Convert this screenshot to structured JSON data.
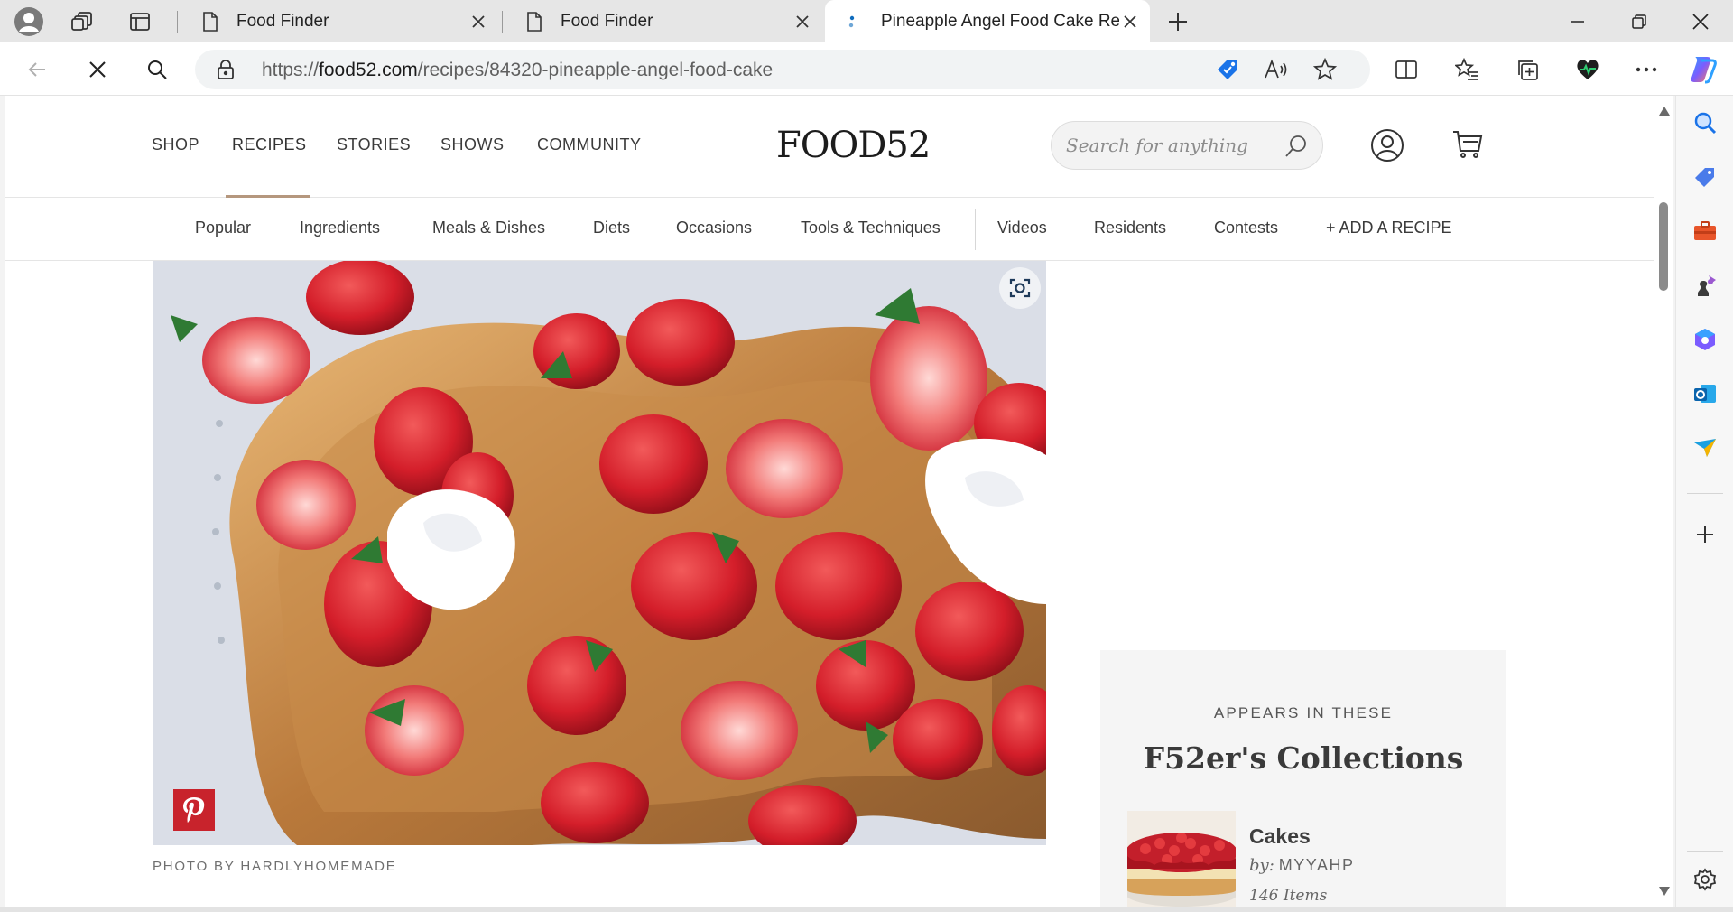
{
  "browser": {
    "tabs": [
      {
        "title": "Food Finder",
        "active": false
      },
      {
        "title": "Food Finder",
        "active": false
      },
      {
        "title": "Pineapple Angel Food Cake Recip",
        "active": true
      }
    ],
    "url_prefix": "https://",
    "url_domain": "food52.com",
    "url_path": "/recipes/84320-pineapple-angel-food-cake",
    "icons": {
      "profile": "profile-icon",
      "workspaces": "workspaces-icon",
      "vertical_tabs": "vertical-tabs-icon",
      "back": "back-arrow-icon",
      "stop": "stop-loading-icon",
      "search": "search-icon",
      "lock": "lock-icon",
      "new_tab": "plus-icon",
      "minimize": "minimize-icon",
      "restore": "restore-icon",
      "close": "close-icon"
    },
    "accent_color": "#0f6cbd"
  },
  "site": {
    "logo": "FOOD52",
    "main_nav": [
      {
        "label": "SHOP"
      },
      {
        "label": "RECIPES",
        "active": true
      },
      {
        "label": "STORIES"
      },
      {
        "label": "SHOWS"
      },
      {
        "label": "COMMUNITY"
      }
    ],
    "search_placeholder": "Search for anything",
    "sub_nav": [
      {
        "label": "Popular"
      },
      {
        "label": "Ingredients"
      },
      {
        "label": "Meals & Dishes"
      },
      {
        "label": "Diets"
      },
      {
        "label": "Occasions"
      },
      {
        "label": "Tools & Techniques"
      },
      {
        "label": "Videos"
      },
      {
        "label": "Residents"
      },
      {
        "label": "Contests"
      },
      {
        "label": "+ ADD A RECIPE"
      }
    ],
    "accent_underline_color": "#b5977e",
    "pinterest_color": "#c8232c"
  },
  "recipe": {
    "photo_credit": "PHOTO BY HARDLYHOMEMADE"
  },
  "collections": {
    "heading": "APPEARS IN THESE",
    "title": "F52er's Collections",
    "item": {
      "name": "Cakes",
      "by_label": "by:",
      "user": "MYYAHP",
      "count": "146 Items"
    }
  }
}
